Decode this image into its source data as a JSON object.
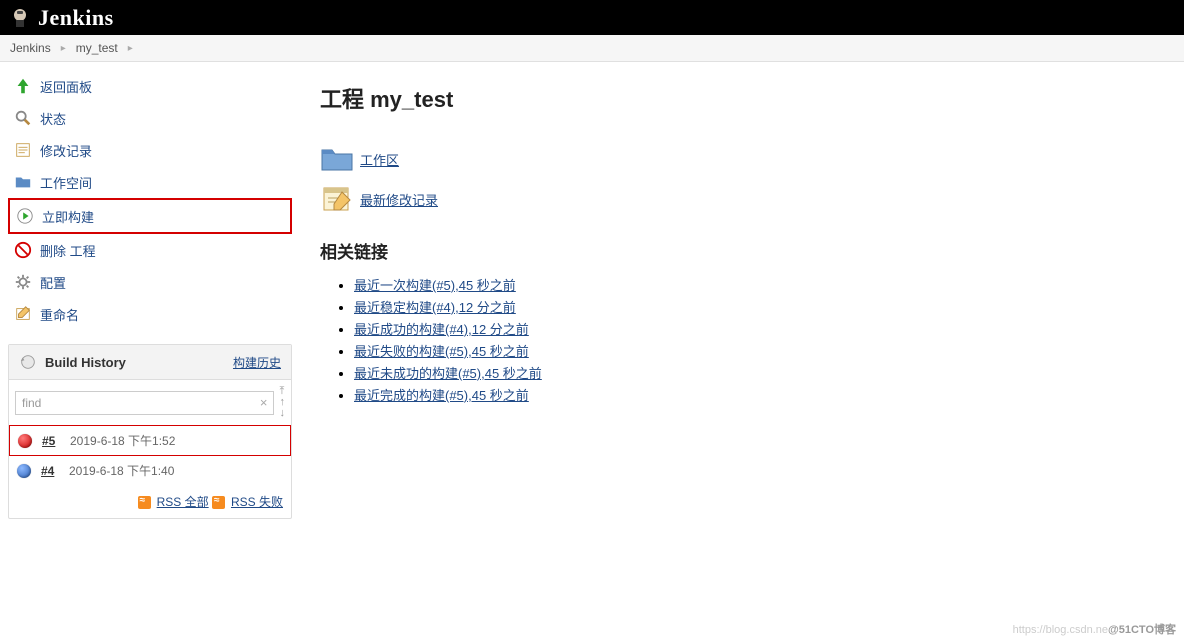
{
  "header": {
    "brand": "Jenkins"
  },
  "breadcrumb": {
    "root": "Jenkins",
    "project": "my_test"
  },
  "sidebar": {
    "tasks": [
      {
        "label": "返回面板"
      },
      {
        "label": "状态"
      },
      {
        "label": "修改记录"
      },
      {
        "label": "工作空间"
      },
      {
        "label": "立即构建"
      },
      {
        "label": "删除 工程"
      },
      {
        "label": "配置"
      },
      {
        "label": "重命名"
      }
    ]
  },
  "buildHistory": {
    "title": "Build History",
    "trend": "构建历史",
    "searchValue": "find",
    "builds": [
      {
        "num": "#5",
        "date": "2019-6-18 下午1:52",
        "status": "red"
      },
      {
        "num": "#4",
        "date": "2019-6-18 下午1:40",
        "status": "blue"
      }
    ],
    "rssAll": "RSS 全部",
    "rssFail": "RSS 失败"
  },
  "main": {
    "title": "工程 my_test",
    "links": [
      {
        "label": "工作区"
      },
      {
        "label": "最新修改记录"
      }
    ],
    "relatedTitle": "相关链接",
    "related": [
      "最近一次构建(#5),45 秒之前",
      "最近稳定构建(#4),12 分之前",
      "最近成功的构建(#4),12 分之前",
      "最近失败的构建(#5),45 秒之前",
      "最近未成功的构建(#5),45 秒之前",
      "最近完成的构建(#5),45 秒之前"
    ]
  },
  "watermark": "@51CTO博客"
}
